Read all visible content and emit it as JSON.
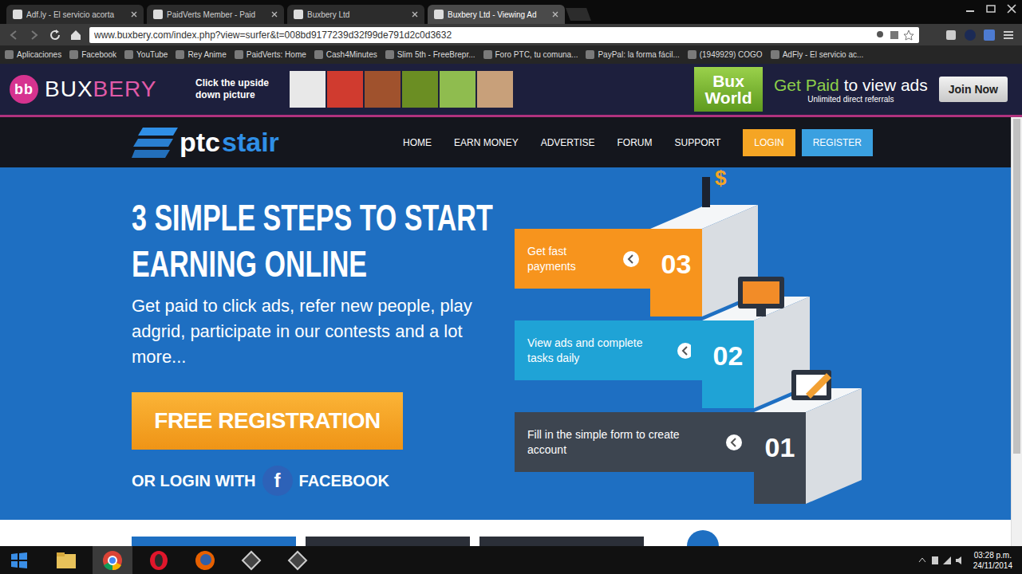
{
  "browser": {
    "tabs": [
      {
        "label": "Adf.ly - El servicio acorta",
        "selected": false
      },
      {
        "label": "PaidVerts Member - Paid",
        "selected": false
      },
      {
        "label": "Buxbery Ltd",
        "selected": false
      },
      {
        "label": "Buxbery Ltd - Viewing Ad",
        "selected": true
      }
    ],
    "address": "www.buxbery.com/index.php?view=surfer&t=008bd9177239d32f99de791d2c0d3632",
    "bookmarks": [
      "Aplicaciones",
      "Facebook",
      "YouTube",
      "Rey Anime",
      "PaidVerts: Home",
      "Cash4Minutes",
      "Slim 5th - FreeBrepr...",
      "Foro PTC, tu comuna...",
      "PayPal: la forma fácil...",
      "(1949929) COGO",
      "AdFly - El servicio ac..."
    ]
  },
  "banner": {
    "logo_icon": "bb",
    "logo": [
      "BUX",
      "BERY"
    ],
    "prompt": "Click the upside down picture",
    "ad": {
      "brand": [
        "Bux",
        "World"
      ],
      "headline": [
        "Get Paid",
        "to view ads"
      ],
      "sub": "Unlimited direct referrals",
      "button": "Join Now"
    }
  },
  "site": {
    "logo": [
      "ptc",
      "stair"
    ],
    "nav": [
      {
        "label": "HOME",
        "kind": "link"
      },
      {
        "label": "EARN MONEY",
        "kind": "link"
      },
      {
        "label": "ADVERTISE",
        "kind": "link"
      },
      {
        "label": "FORUM",
        "kind": "link"
      },
      {
        "label": "SUPPORT",
        "kind": "link"
      },
      {
        "label": "LOGIN",
        "kind": "login"
      },
      {
        "label": "REGISTER",
        "kind": "register"
      }
    ],
    "hero": {
      "title": [
        "3 SIMPLE STEPS TO START",
        "EARNING ONLINE"
      ],
      "text": "Get paid to click ads, refer new people, play adgrid, participate in our contests and a lot more...",
      "cta": "FREE REGISTRATION",
      "login_prefix": "OR LOGIN WITH",
      "facebook_icon": "f",
      "login_provider": "FACEBOOK"
    },
    "coin": "$",
    "steps": [
      {
        "number": "03",
        "label": "Get fast payments",
        "color": "#f7941d"
      },
      {
        "number": "02",
        "label": "View ads and complete tasks daily",
        "color": "#1fa3d6"
      },
      {
        "number": "01",
        "label": "Fill in the simple form to create account",
        "color": "#3d4550"
      }
    ]
  },
  "taskbar": {
    "apps": [
      {
        "kind": "explorer",
        "selected": false
      },
      {
        "kind": "chrome",
        "selected": true
      },
      {
        "kind": "opera",
        "selected": false
      },
      {
        "kind": "firefox",
        "selected": false
      },
      {
        "kind": "app",
        "selected": false
      },
      {
        "kind": "app",
        "selected": false
      }
    ],
    "time": "03:28 p.m.",
    "date": "24/11/2014"
  }
}
